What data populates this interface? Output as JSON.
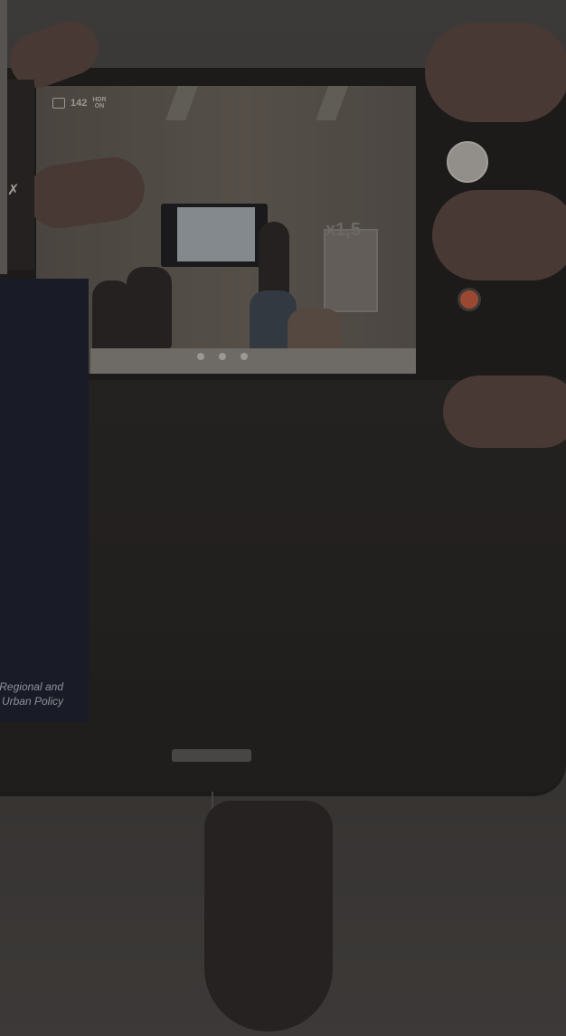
{
  "camera": {
    "photo_count": "142",
    "hdr_top": "HDR",
    "hdr_bottom": "ON",
    "zoom": "x1,5",
    "icons": {
      "gallery": "gallery-icon",
      "thumbnail": "thumbnail-preview",
      "shutter": "shutter-button",
      "record": "record-button"
    },
    "record_color": "#c85a3c"
  },
  "panel": {
    "caption_line1": "Regional and",
    "caption_line2": "Urban Policy",
    "background": "#1b1e2c"
  },
  "flash_glyph": "✗"
}
